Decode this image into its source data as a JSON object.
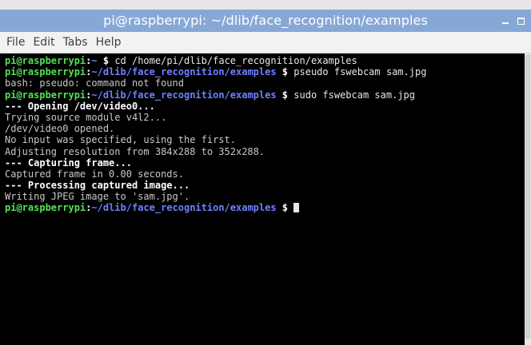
{
  "window": {
    "title": "pi@raspberrypi: ~/dlib/face_recognition/examples",
    "min_icon": "minimize-icon",
    "max_icon": "maximize-icon"
  },
  "menu": [
    "File",
    "Edit",
    "Tabs",
    "Help"
  ],
  "terminal": {
    "lines": [
      {
        "type": "prompt",
        "user": "pi@raspberrypi",
        "sep": ":",
        "path": "~",
        "dollar": " $ ",
        "cmd": "cd /home/pi/dlib/face_recognition/examples"
      },
      {
        "type": "prompt",
        "user": "pi@raspberrypi",
        "sep": ":",
        "path": "~/dlib/face_recognition/examples",
        "dollar": " $ ",
        "cmd": "pseudo fswebcam sam.jpg"
      },
      {
        "type": "out",
        "text": "bash: pseudo: command not found"
      },
      {
        "type": "prompt",
        "user": "pi@raspberrypi",
        "sep": ":",
        "path": "~/dlib/face_recognition/examples",
        "dollar": " $ ",
        "cmd": "sudo fswebcam sam.jpg"
      },
      {
        "type": "bold",
        "text": "--- Opening /dev/video0..."
      },
      {
        "type": "out",
        "text": "Trying source module v4l2..."
      },
      {
        "type": "out",
        "text": "/dev/video0 opened."
      },
      {
        "type": "out",
        "text": "No input was specified, using the first."
      },
      {
        "type": "out",
        "text": "Adjusting resolution from 384x288 to 352x288."
      },
      {
        "type": "bold",
        "text": "--- Capturing frame..."
      },
      {
        "type": "out",
        "text": "Captured frame in 0.00 seconds."
      },
      {
        "type": "bold",
        "text": "--- Processing captured image..."
      },
      {
        "type": "out",
        "text": "Writing JPEG image to 'sam.jpg'."
      },
      {
        "type": "prompt",
        "user": "pi@raspberrypi",
        "sep": ":",
        "path": "~/dlib/face_recognition/examples",
        "dollar": " $ ",
        "cmd": "",
        "cursor": true
      }
    ]
  },
  "colors": {
    "titlebar": "#87a8d6",
    "prompt_user": "#55e055",
    "prompt_path": "#6f80ff",
    "background": "#000000"
  }
}
